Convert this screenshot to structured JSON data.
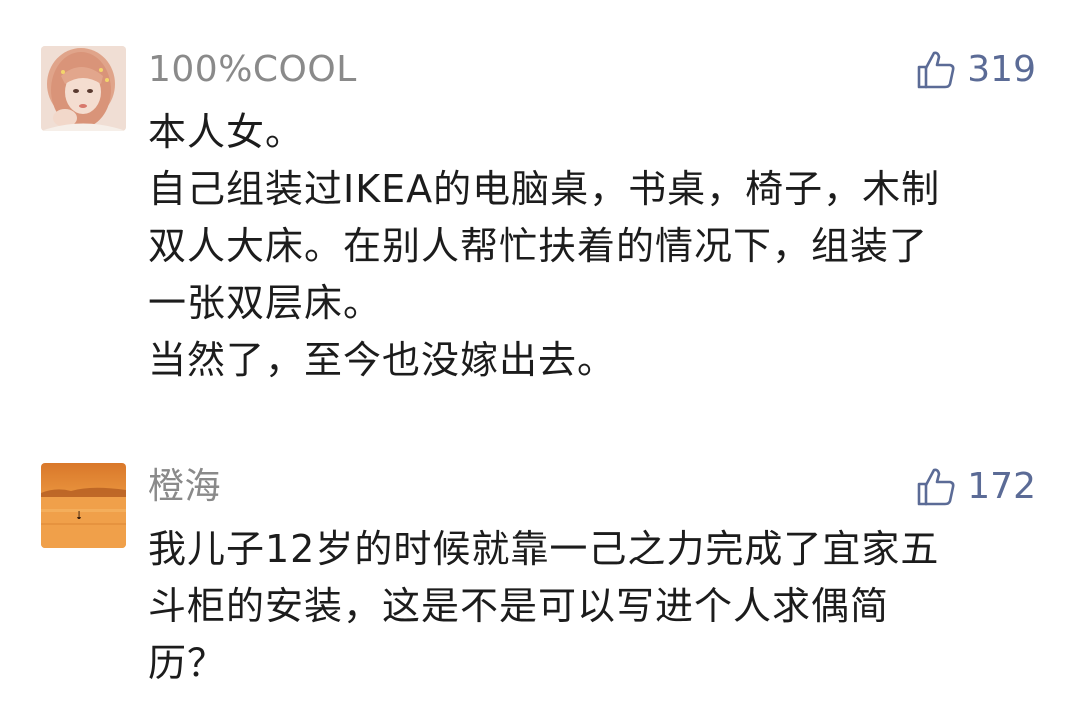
{
  "comments": [
    {
      "username": "100%COOL",
      "likes": "319",
      "avatar_icon": "girl-portrait-avatar",
      "lines": [
        "本人女。",
        "自己组装过IKEA的电脑桌，书桌，椅子，木制",
        "双人大床。在别人帮忙扶着的情况下，组装了",
        "一张双层床。",
        "当然了，至今也没嫁出去。"
      ]
    },
    {
      "username": "橙海",
      "likes": "172",
      "avatar_icon": "sunset-sea-avatar",
      "lines": [
        "我儿子12岁的时候就靠一己之力完成了宜家五",
        "斗柜的安装，这是不是可以写进个人求偶简",
        "历？"
      ]
    }
  ],
  "colors": {
    "username": "#8a8a8a",
    "like": "#5b6b96",
    "text": "#1c1c1c"
  }
}
